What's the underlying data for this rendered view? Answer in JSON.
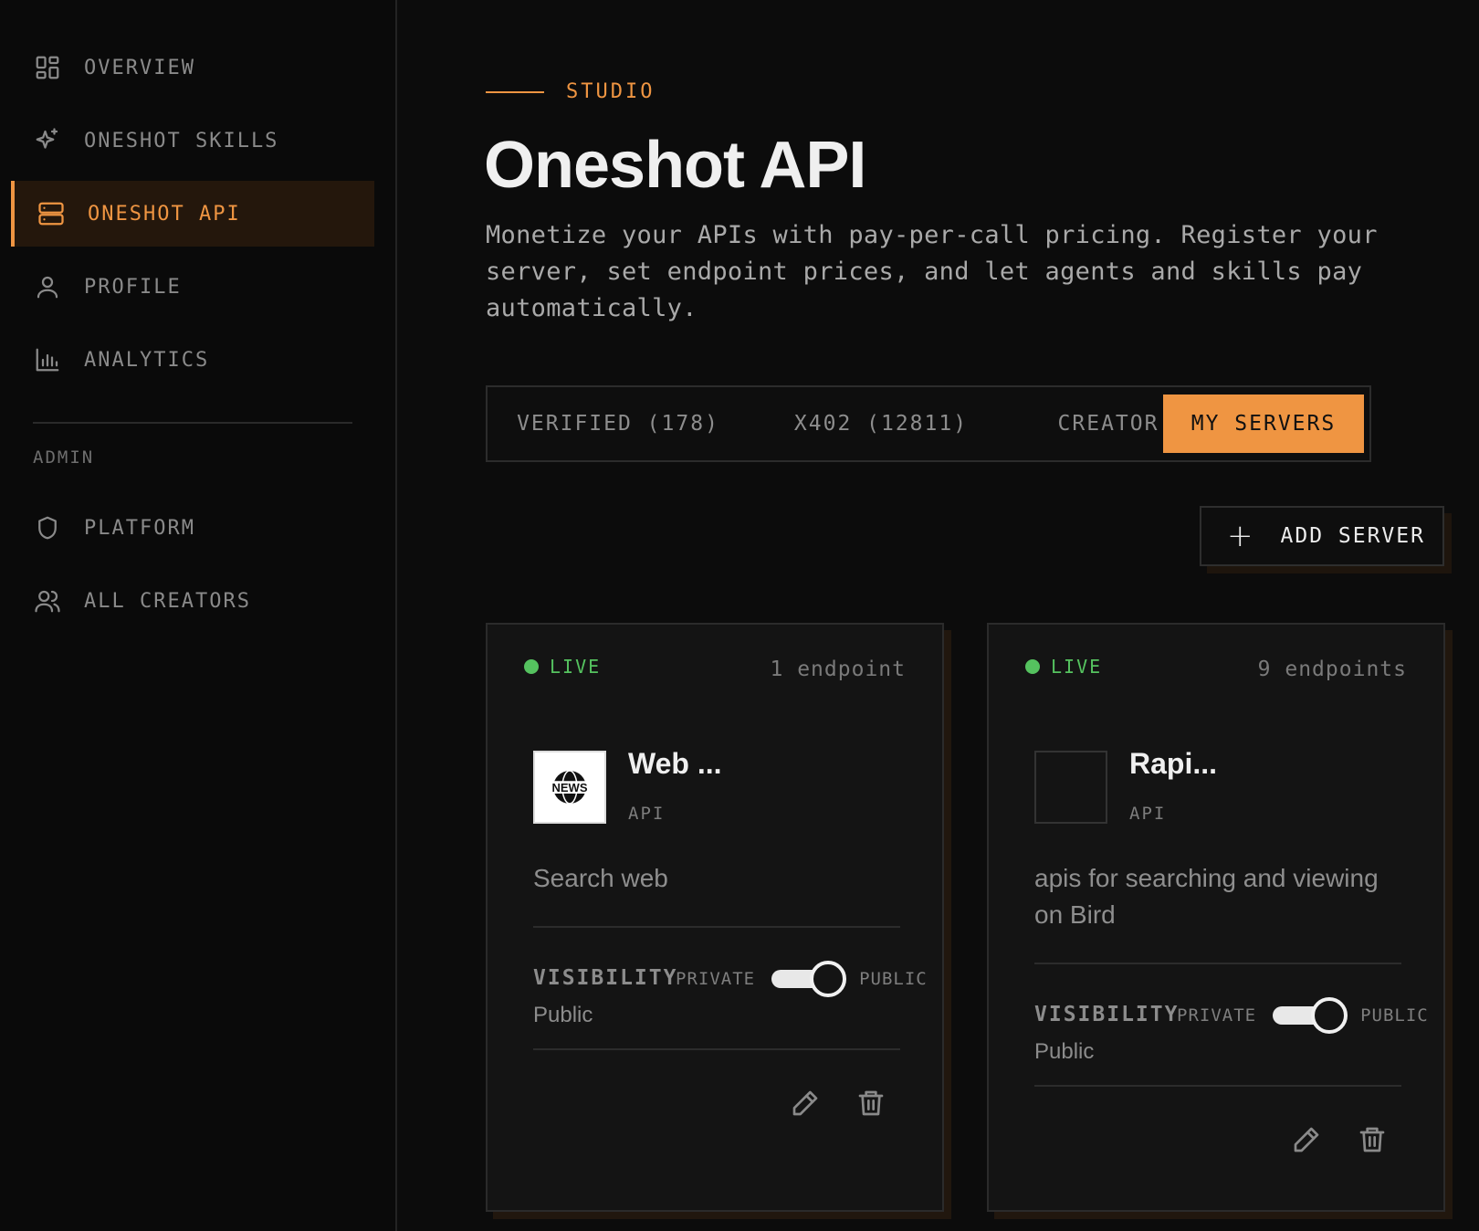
{
  "sidebar": {
    "items": [
      {
        "label": "OVERVIEW",
        "icon": "grid-icon"
      },
      {
        "label": "ONESHOT SKILLS",
        "icon": "sparkle-icon"
      },
      {
        "label": "ONESHOT API",
        "icon": "server-icon",
        "active": true
      },
      {
        "label": "PROFILE",
        "icon": "user-icon"
      },
      {
        "label": "ANALYTICS",
        "icon": "bar-chart-icon"
      }
    ],
    "admin_heading": "ADMIN",
    "admin_items": [
      {
        "label": "PLATFORM",
        "icon": "shield-icon"
      },
      {
        "label": "ALL CREATORS",
        "icon": "users-icon"
      }
    ]
  },
  "header": {
    "eyebrow": "STUDIO",
    "title": "Oneshot API",
    "description": "Monetize your APIs with pay-per-call pricing. Register your server, set endpoint prices, and let agents and skills pay automatically."
  },
  "tabs": [
    {
      "label": "VERIFIED (178)"
    },
    {
      "label": "X402 (12811)"
    },
    {
      "label": "CREATOR"
    },
    {
      "label": "MY SERVERS",
      "active": true
    }
  ],
  "add_server_label": "ADD SERVER",
  "cards": [
    {
      "status": "LIVE",
      "endpoints": "1 endpoint",
      "logo_text": "NEWS",
      "name": "Web ...",
      "type": "API",
      "description": "Search web",
      "visibility_label": "VISIBILITY",
      "visibility_value": "Public",
      "toggle_left": "PRIVATE",
      "toggle_right": "PUBLIC"
    },
    {
      "status": "LIVE",
      "endpoints": "9 endpoints",
      "name": "Rapi...",
      "type": "API",
      "description": "apis for searching and viewing on Bird",
      "visibility_label": "VISIBILITY",
      "visibility_value": "Public",
      "toggle_left": "PRIVATE",
      "toggle_right": "PUBLIC"
    }
  ],
  "colors": {
    "accent": "#ef9542",
    "live": "#55c25f",
    "background": "#0c0c0c"
  }
}
